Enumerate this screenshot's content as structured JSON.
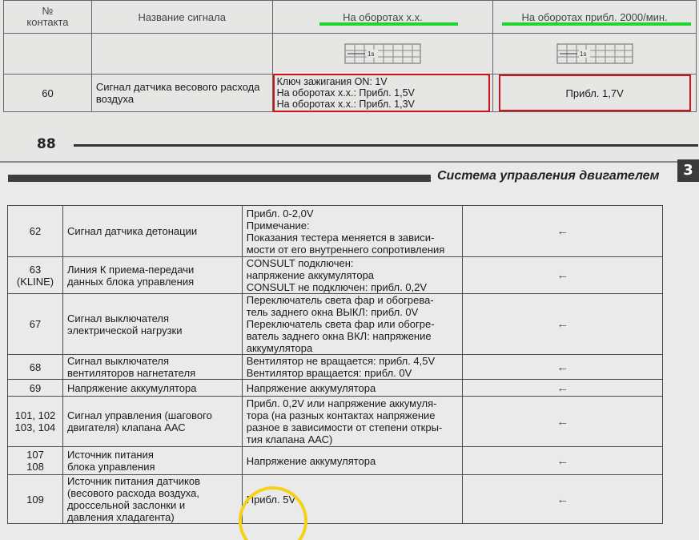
{
  "top_table": {
    "header": {
      "contact_no": "№\nконтакта",
      "signal_name": "Название сигнала",
      "idle": "На оборотах х.х.",
      "rpm2000": "На оборотах прибл. 2000/мин."
    },
    "scope_label": "1s",
    "row_60": {
      "no": "60",
      "name": "Сигнал датчика весового расхода воздуха",
      "idle_lines": [
        "Ключ зажигания ON: 1V",
        "На оборотах х.х.: Прибл. 1,5V",
        "На оборотах х.х.: Прибл. 1,3V"
      ],
      "rpm2000": "Прибл. 1,7V"
    }
  },
  "page_number": "88",
  "section_title": "Система управления двигателем",
  "chapter_tab": "3",
  "bottom_table": {
    "rows": [
      {
        "no": "62",
        "name": "Сигнал датчика детонации",
        "value": "Прибл. 0-2,0V\nПримечание:\nПоказания тестера меняется в зависи-\nмости от его внутреннего сопротивления",
        "arrow": "←"
      },
      {
        "no": "63\n(KLINE)",
        "name": "Линия К приема-передачи\nданных блока управления",
        "value": "CONSULT подключен:\nнапряжение аккумулятора\nCONSULT не подключен: прибл. 0,2V",
        "arrow": "←"
      },
      {
        "no": "67",
        "name": "Сигнал выключателя\nэлектрической нагрузки",
        "value": "Переключатель света фар и обогрева-\nтель заднего окна ВЫКЛ: прибл. 0V\nПереключатель света фар или обогре-\nватель заднего окна ВКЛ: напряжение\nаккумулятора",
        "arrow": "←"
      },
      {
        "no": "68",
        "name": "Сигнал выключателя\nвентиляторов нагнетателя",
        "value": "Вентилятор не вращается: прибл. 4,5V\nВентилятор вращается: прибл. 0V",
        "arrow": "←"
      },
      {
        "no": "69",
        "name": "Напряжение аккумулятора",
        "value": "Напряжение аккумулятора",
        "arrow": "←"
      },
      {
        "no": "101, 102\n103, 104",
        "name": "Сигнал управления (шагового\nдвигателя) клапана ААС",
        "value": "Прибл. 0,2V или напряжение аккумуля-\nтора (на разных контактах напряжение\nразное в зависимости от степени откры-\nтия клапана ААС)",
        "arrow": "←"
      },
      {
        "no": "107\n108",
        "name": "Источник питания\nблока управления",
        "value": "Напряжение аккумулятора",
        "arrow": "←"
      },
      {
        "no": "109",
        "name": "Источник питания датчиков\n(весового расхода воздуха,\nдроссельной заслонки и\nдавления хладагента)",
        "value": "Прибл. 5V",
        "arrow": "←"
      }
    ]
  },
  "annotation_colors": {
    "green": "#22d42e",
    "red": "#d0141b",
    "yellow": "#f4d21a"
  }
}
